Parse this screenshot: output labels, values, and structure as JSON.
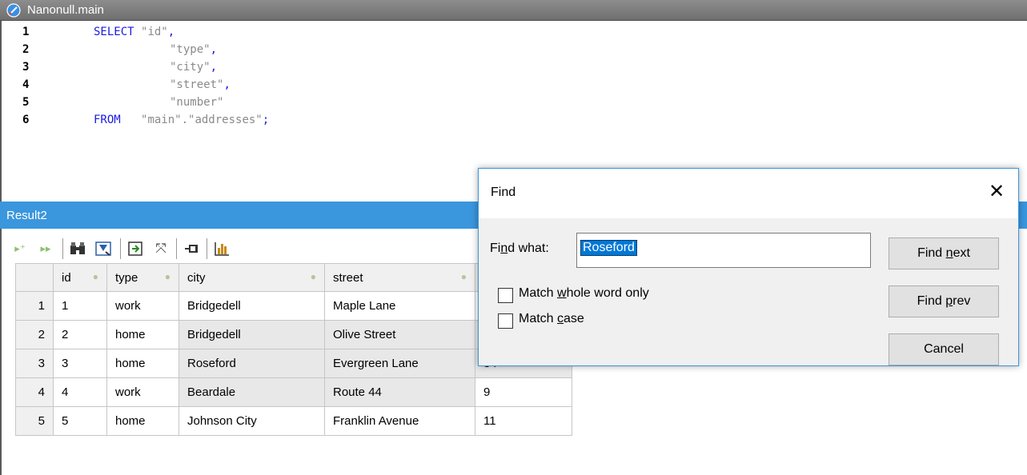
{
  "editor": {
    "title": "Nanonull.main",
    "lines": [
      {
        "n": "1",
        "kw": "SELECT ",
        "str": "\"id\"",
        "punc": ","
      },
      {
        "n": "2",
        "kw": "",
        "str": "\"type\"",
        "punc": ","
      },
      {
        "n": "3",
        "kw": "",
        "str": "\"city\"",
        "punc": ","
      },
      {
        "n": "4",
        "kw": "",
        "str": "\"street\"",
        "punc": ","
      },
      {
        "n": "5",
        "kw": "",
        "str": "\"number\"",
        "punc": ""
      },
      {
        "n": "6",
        "kw": "FROM   ",
        "str": "\"main\".\"addresses\"",
        "punc": ";"
      }
    ]
  },
  "result": {
    "title": "Result2",
    "columns": [
      "id",
      "type",
      "city",
      "street",
      ""
    ],
    "rows": [
      {
        "rn": "1",
        "cells": [
          "1",
          "work",
          "Bridgedell",
          "Maple Lane",
          ""
        ]
      },
      {
        "rn": "2",
        "cells": [
          "2",
          "home",
          "Bridgedell",
          "Olive Street",
          ""
        ]
      },
      {
        "rn": "3",
        "cells": [
          "3",
          "home",
          "Roseford",
          "Evergreen Lane",
          "34"
        ]
      },
      {
        "rn": "4",
        "cells": [
          "4",
          "work",
          "Beardale",
          "Route 44",
          "9"
        ]
      },
      {
        "rn": "5",
        "cells": [
          "5",
          "home",
          "Johnson City",
          "Franklin Avenue",
          "11"
        ]
      }
    ]
  },
  "find": {
    "title": "Find",
    "close": "✕",
    "find_what_label_pre": "Fi",
    "find_what_label_u": "n",
    "find_what_label_post": "d what:",
    "value": "Roseford",
    "whole_word_pre": "Match ",
    "whole_word_u": "w",
    "whole_word_post": "hole word only",
    "case_pre": "Match ",
    "case_u": "c",
    "case_post": "ase",
    "find_next_pre": "Find ",
    "find_next_u": "n",
    "find_next_post": "ext",
    "find_prev_pre": "Find ",
    "find_prev_u": "p",
    "find_prev_post": "rev",
    "cancel": "Cancel"
  }
}
